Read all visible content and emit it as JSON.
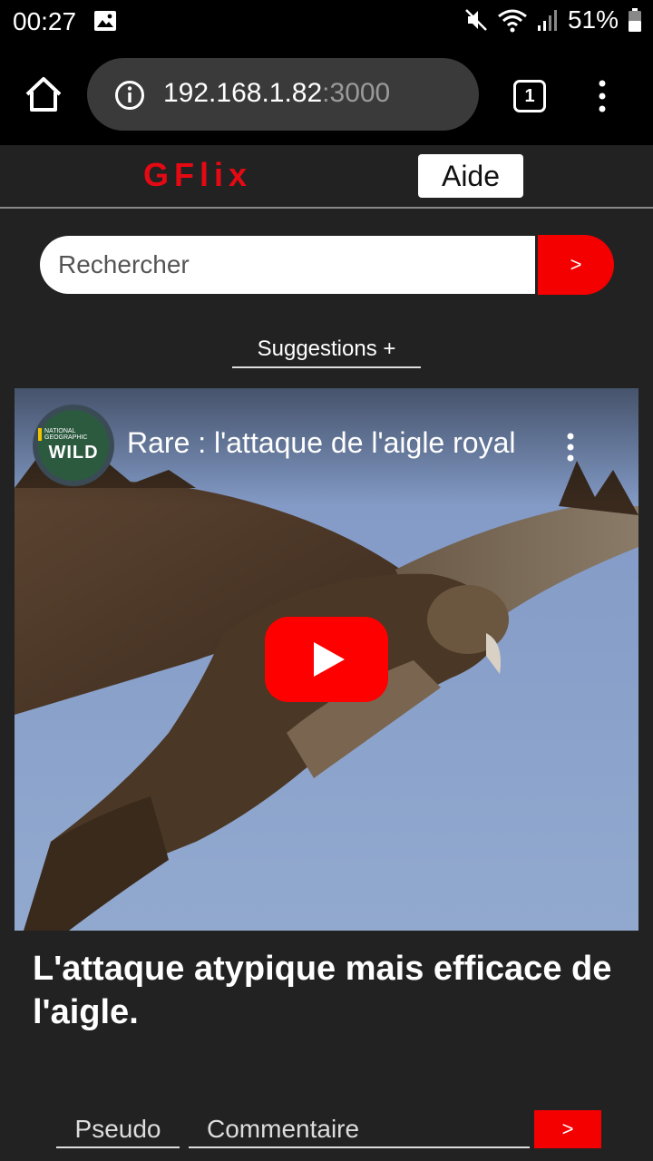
{
  "status_bar": {
    "time": "00:27",
    "battery": "51%",
    "icons": [
      "gallery-icon",
      "mute-icon",
      "wifi-icon",
      "signal-icon",
      "battery-icon"
    ]
  },
  "browser": {
    "url_host": "192.168.1.82",
    "url_port": ":3000",
    "tab_count": "1"
  },
  "header": {
    "logo": "GFlix",
    "help_label": "Aide"
  },
  "search": {
    "placeholder": "Rechercher",
    "button_label": ">"
  },
  "suggestions_label": "Suggestions +",
  "video": {
    "channel_tag": "NATIONAL GEOGRAPHIC",
    "channel_brand": "WILD",
    "title": "Rare : l'attaque de l'aigle royal",
    "caption": "L'attaque atypique mais efficace de l'aigle."
  },
  "comment_form": {
    "pseudo_placeholder": "Pseudo",
    "comment_placeholder": "Commentaire",
    "submit_label": ">"
  },
  "colors": {
    "brand_red": "#e50914",
    "button_red": "#f40000",
    "background": "#222222",
    "youtube_red": "#ff0000"
  }
}
